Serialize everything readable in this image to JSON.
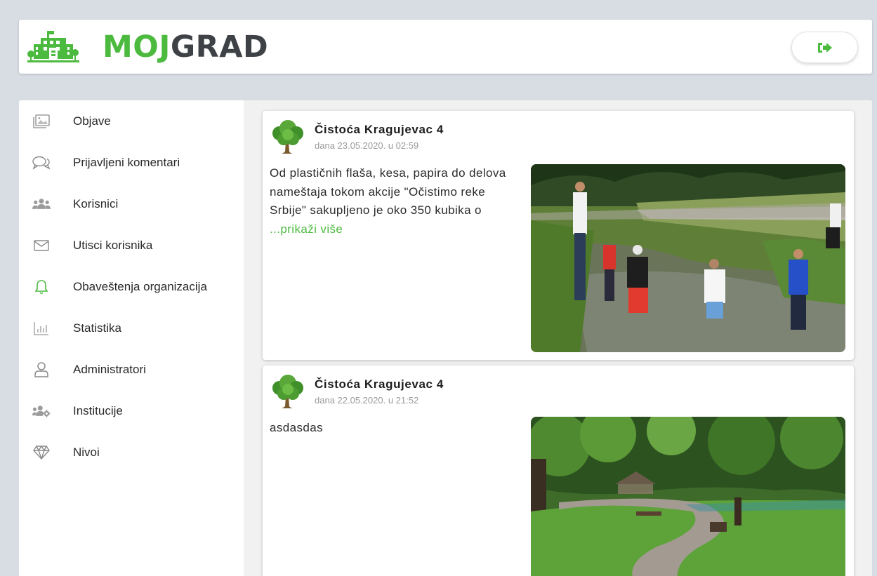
{
  "header": {
    "brand_part1": "MOJ",
    "brand_part2": "GRAD",
    "logout_icon": "sign-out-icon"
  },
  "sidebar": {
    "items": [
      {
        "label": "Objave",
        "icon": "image-icon"
      },
      {
        "label": "Prijavljeni komentari",
        "icon": "comments-icon"
      },
      {
        "label": "Korisnici",
        "icon": "users-icon"
      },
      {
        "label": "Utisci korisnika",
        "icon": "envelope-icon"
      },
      {
        "label": "Obaveštenja organizacija",
        "icon": "bell-icon"
      },
      {
        "label": "Statistika",
        "icon": "bar-chart-icon"
      },
      {
        "label": "Administratori",
        "icon": "user-icon"
      },
      {
        "label": "Institucije",
        "icon": "users-cog-icon"
      },
      {
        "label": "Nivoi",
        "icon": "diamond-icon"
      }
    ]
  },
  "posts": [
    {
      "author": "Čistoća Kragujevac 4",
      "date": "dana 23.05.2020. u 02:59",
      "text": "Od plastičnih flaša, kesa, papira do delova nameštaja tokom akcije \"Očistimo reke Srbije\" sakupljeno je oko 350 kubika o ",
      "more": "...prikaži više"
    },
    {
      "author": "Čistoća Kragujevac 4",
      "date": "dana 22.05.2020. u 21:52",
      "text": "asdasdas"
    }
  ],
  "colors": {
    "accent": "#4cba3f",
    "brand_dark": "#3e4246",
    "background": "#d7dde3",
    "feed_background": "#f1f1f1"
  }
}
